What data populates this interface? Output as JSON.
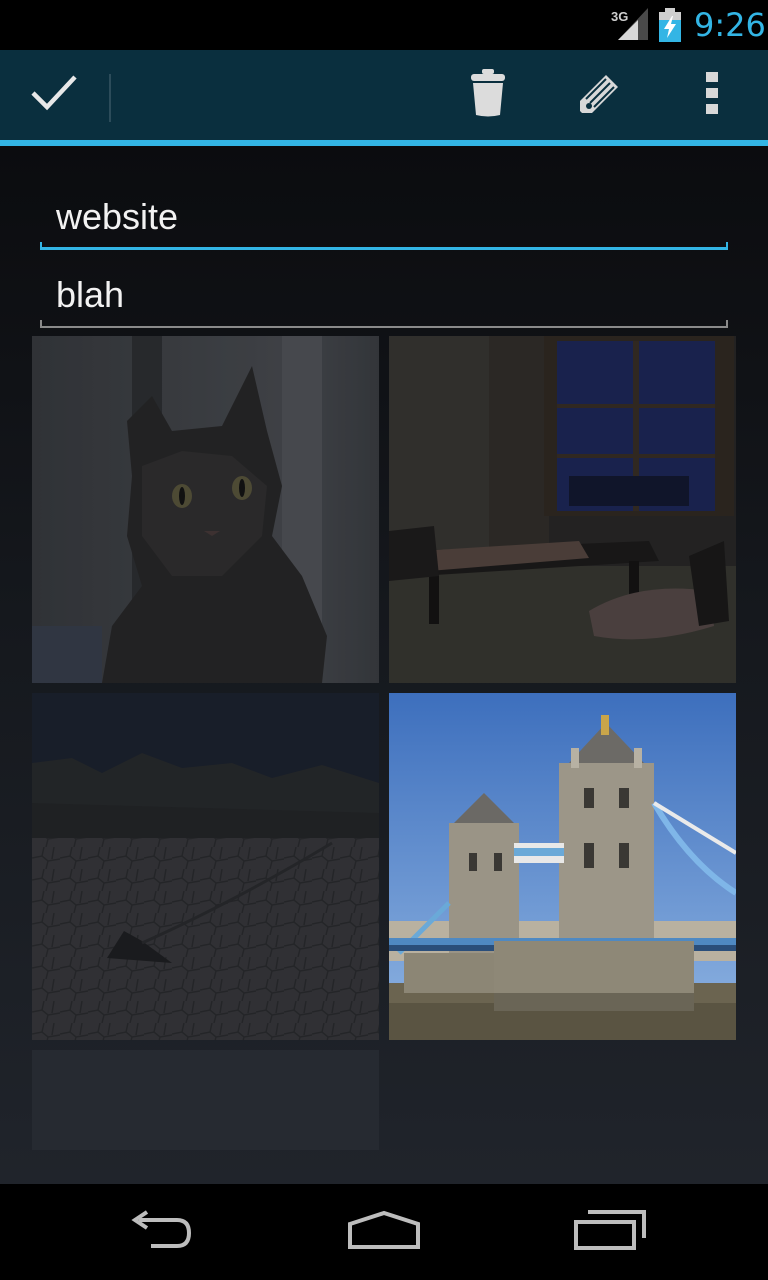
{
  "status_bar": {
    "network": "3G",
    "time": "9:26",
    "signal_icon": "signal-icon",
    "battery_icon": "battery-charging-icon",
    "accent_color": "#33b5e5"
  },
  "action_bar": {
    "done_icon": "checkmark-icon",
    "delete_icon": "trash-icon",
    "edit_icon": "pencil-icon",
    "overflow_icon": "more-vert-icon",
    "background_color": "#0a2f3e",
    "underline_color": "#33b5e5"
  },
  "note": {
    "title": "website",
    "body": "blah"
  },
  "photos": [
    {
      "subject": "cat",
      "dimmed": true
    },
    {
      "subject": "room",
      "dimmed": true
    },
    {
      "subject": "desert",
      "dimmed": true
    },
    {
      "subject": "bridge",
      "dimmed": false
    }
  ],
  "nav_bar": {
    "back_icon": "back-icon",
    "home_icon": "home-icon",
    "recents_icon": "recents-icon"
  }
}
